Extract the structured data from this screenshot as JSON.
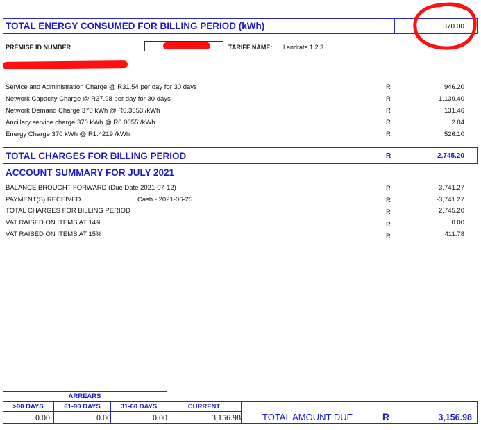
{
  "energy": {
    "label": "TOTAL ENERGY CONSUMED FOR BILLING PERIOD (kWh)",
    "value": "370.00"
  },
  "premise": {
    "label": "PREMISE ID NUMBER",
    "tariff_label": "TARIFF NAME:",
    "tariff_value": "Landrate 1,2,3"
  },
  "charges": [
    {
      "description": "Service and Administration Charge @ R31.54 per day for 30 days",
      "currency": "R",
      "amount": "946.20"
    },
    {
      "description": "Network Capacity Charge @ R37.98 per day for 30 days",
      "currency": "R",
      "amount": "1,139.40"
    },
    {
      "description": "Network Demand Charge 370 kWh @ R0.3553 /kWh",
      "currency": "R",
      "amount": "131.46"
    },
    {
      "description": "Ancillary service charge 370 kWh @ R0.0055 /kWh",
      "currency": "R",
      "amount": "2.04"
    },
    {
      "description": "Energy Charge 370 kWh @ R1.4219 /kWh",
      "currency": "R",
      "amount": "526.10"
    }
  ],
  "total_charges": {
    "label": "TOTAL CHARGES FOR BILLING PERIOD",
    "currency": "R",
    "amount": "2,745.20"
  },
  "summary": {
    "title": "ACCOUNT SUMMARY FOR JULY 2021",
    "rows": [
      {
        "description": "BALANCE BROUGHT FORWARD (Due Date 2021-07-12)",
        "extra": "",
        "currency": "R",
        "amount": "3,741.27"
      },
      {
        "description": "PAYMENT(S) RECEIVED",
        "extra": "Cash - 2021-06-25",
        "currency": "R",
        "amount": "-3,741.27"
      },
      {
        "description": "TOTAL CHARGES FOR BILLING PERIOD",
        "extra": "",
        "currency": "R",
        "amount": "2,745.20"
      },
      {
        "description": "VAT RAISED ON ITEMS AT 14%",
        "extra": "",
        "currency": "R",
        "amount": "0.00"
      },
      {
        "description": "VAT RAISED ON ITEMS AT 15%",
        "extra": "",
        "currency": "R",
        "amount": "411.78"
      }
    ]
  },
  "arrears": {
    "title": "ARREARS",
    "headers": [
      ">90 DAYS",
      "61-90 DAYS",
      "31-60 DAYS",
      "CURRENT"
    ],
    "values": [
      "0.00",
      "0.00",
      "0.00",
      "3,156.98"
    ]
  },
  "total_due": {
    "label": "TOTAL AMOUNT DUE",
    "currency": "R",
    "amount": "3,156.98"
  },
  "colors": {
    "accent": "#1a1acc",
    "annotation": "#ff1010",
    "redaction": "#ff1010"
  }
}
